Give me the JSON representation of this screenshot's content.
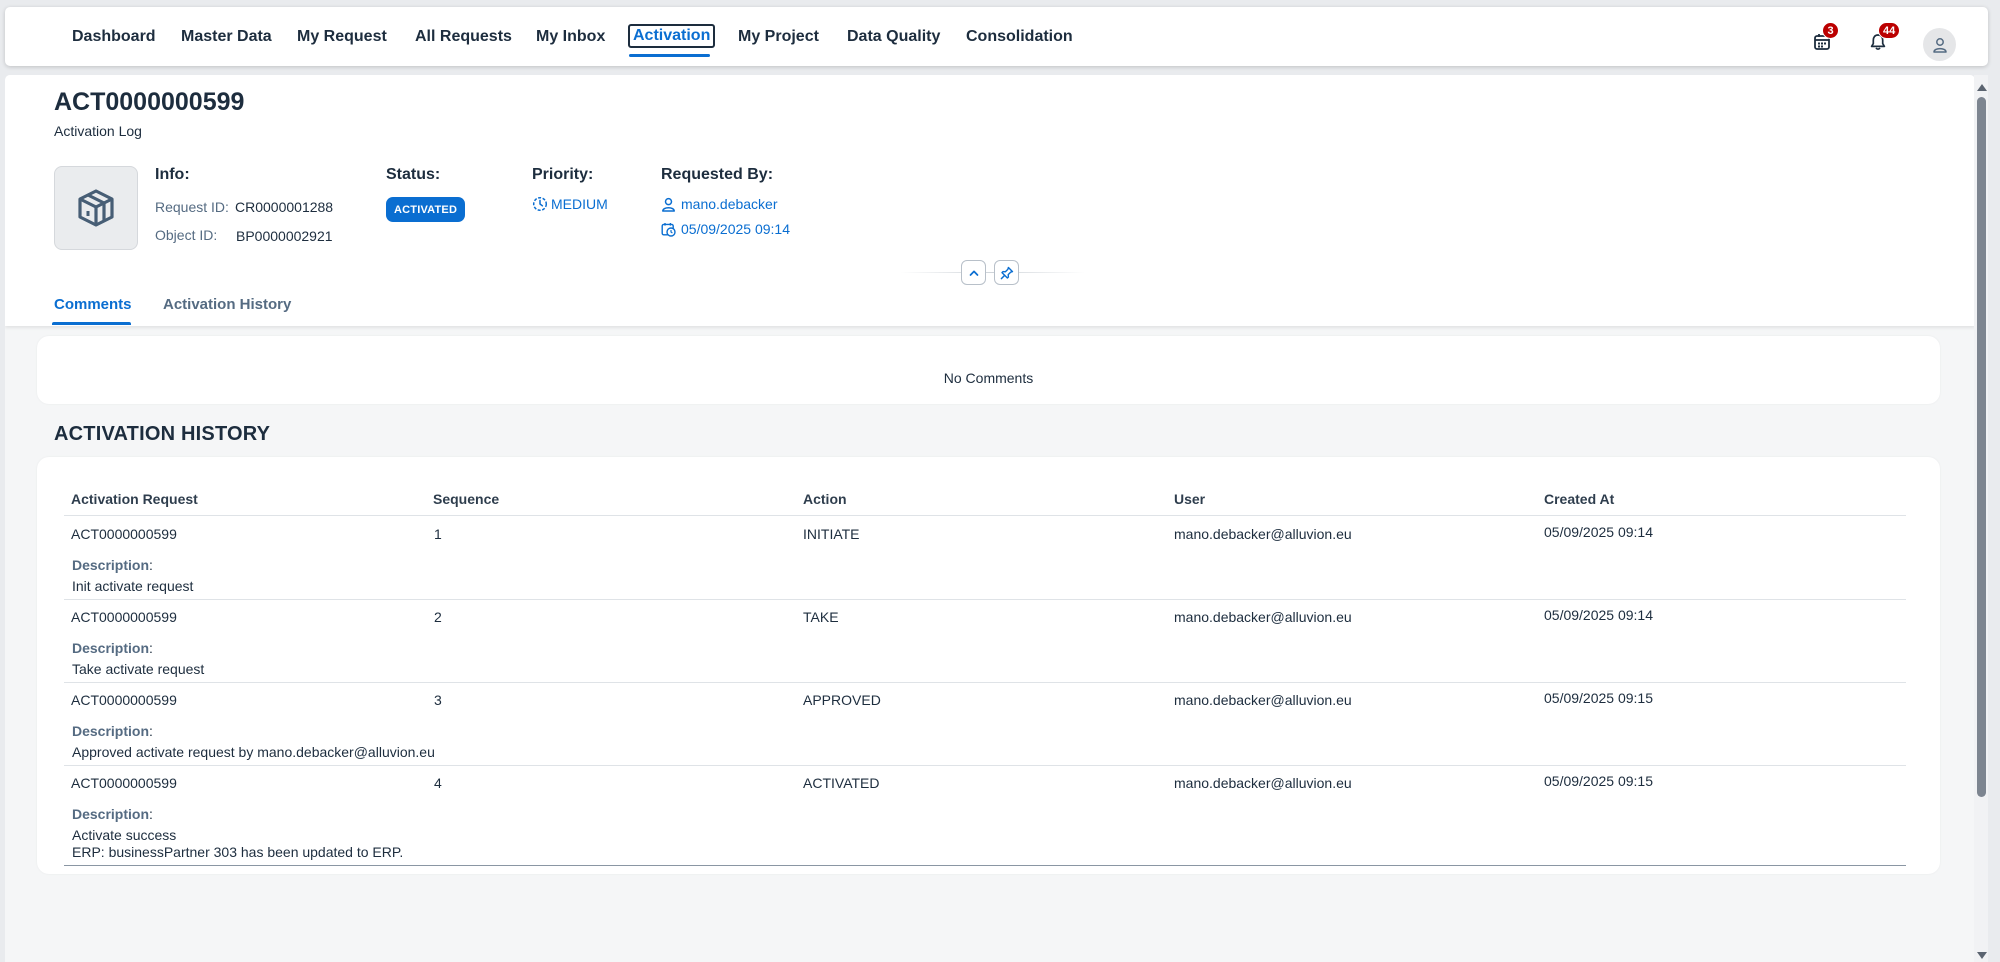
{
  "nav": {
    "items": [
      {
        "label": "Dashboard"
      },
      {
        "label": "Master Data"
      },
      {
        "label": "My Request"
      },
      {
        "label": "All Requests"
      },
      {
        "label": "My Inbox"
      },
      {
        "label": "Activation"
      },
      {
        "label": "My Project"
      },
      {
        "label": "Data Quality"
      },
      {
        "label": "Consolidation"
      }
    ],
    "active": "Activation",
    "calendar_badge": "3",
    "notification_badge": "44",
    "icons": [
      "calendar-icon",
      "bell-icon",
      "user-icon"
    ]
  },
  "header": {
    "title": "ACT0000000599",
    "subtitle": "Activation Log",
    "info": {
      "title": "Info:",
      "request_id_label": "Request ID:",
      "request_id": "CR0000001288",
      "object_id_label": "Object ID:",
      "object_id": "BP0000002921"
    },
    "status": {
      "title": "Status:",
      "value": "ACTIVATED",
      "color": "#0a6ed1"
    },
    "priority": {
      "title": "Priority:",
      "value": "MEDIUM"
    },
    "requested_by": {
      "title": "Requested By:",
      "user": "mano.debacker",
      "date": "05/09/2025 09:14"
    }
  },
  "tabs": [
    {
      "label": "Comments",
      "selected": true
    },
    {
      "label": "Activation History",
      "selected": false
    }
  ],
  "comments": {
    "empty_text": "No Comments"
  },
  "history": {
    "title": "ACTIVATION HISTORY",
    "columns": [
      "Activation Request",
      "Sequence",
      "Action",
      "User",
      "Created At"
    ],
    "description_label": "Description",
    "rows": [
      {
        "request": "ACT0000000599",
        "sequence": "1",
        "action": "INITIATE",
        "user": "mano.debacker@alluvion.eu",
        "created": "05/09/2025 09:14",
        "description": [
          "Init activate request"
        ]
      },
      {
        "request": "ACT0000000599",
        "sequence": "2",
        "action": "TAKE",
        "user": "mano.debacker@alluvion.eu",
        "created": "05/09/2025 09:14",
        "description": [
          "Take activate request"
        ]
      },
      {
        "request": "ACT0000000599",
        "sequence": "3",
        "action": "APPROVED",
        "user": "mano.debacker@alluvion.eu",
        "created": "05/09/2025 09:15",
        "description": [
          "Approved activate request by mano.debacker@alluvion.eu"
        ]
      },
      {
        "request": "ACT0000000599",
        "sequence": "4",
        "action": "ACTIVATED",
        "user": "mano.debacker@alluvion.eu",
        "created": "05/09/2025 09:15",
        "description": [
          "Activate success",
          "ERP: businessPartner 303 has been updated to ERP."
        ]
      }
    ]
  },
  "colors": {
    "accent": "#0a6ed1",
    "badge": "#bb0000",
    "text": "#1d2d3e"
  }
}
